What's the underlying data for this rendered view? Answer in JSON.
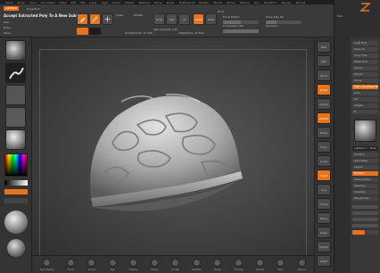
{
  "menubar": {
    "items": [
      "Alpha",
      "Brush",
      "Color",
      "Document",
      "Draw",
      "Edit",
      "File",
      "Layer",
      "Light",
      "Macro",
      "Marker",
      "Material",
      "Movie",
      "Picker",
      "Preferences",
      "Render",
      "Stencil",
      "Stroke",
      "Texture",
      "Tool",
      "Transform",
      "Zplugin",
      "Zscript"
    ],
    "quick_menu_label": "?"
  },
  "toptools": {
    "lightbox_label": "LightBox",
    "projection_label": "Projection",
    "accept_label": "Accept Extracted Poly To A New Subtool",
    "scale_label": "Scale",
    "rotate_label": "Rotate",
    "mrgb_label": "Mrgb",
    "rgb_label": "Rgb",
    "m_label": "M",
    "zadd_label": "Zadd",
    "zsub_label": "Zsub",
    "zcut_label": "Zcut",
    "focal_label": "Focal Shift 0",
    "intensity_label": "Z Intensity 100",
    "draw_size_label": "Draw Size 64",
    "dynamic_label": "Dynamic",
    "active_points": "ActivePoints: 47,529",
    "total_points": "TotalPoints: 47,529",
    "rgb_intensity_label": "Rgb Intensity 100",
    "edit_label": "Edit",
    "draw_label": "Draw",
    "move_label": "Move",
    "scale_tool_label": "Scale",
    "rotate_tool_label": "Rotate"
  },
  "colors": {
    "accent": "#e8731b",
    "ui_bg": "#3a3a3a",
    "dark_bg": "#2a2a2a",
    "mesh": "#b5b5b5"
  },
  "leftshelf": {
    "items": [
      "Brush",
      "Stroke",
      "Alpha",
      "Texture",
      "Material",
      "Color",
      "Gradient",
      "SwitchColor",
      "Alternate"
    ]
  },
  "bottombar": {
    "items": [
      "Symmetry",
      "Floor",
      "Local",
      "Xyz",
      "Frame",
      "Move",
      "Scale",
      "Rotate",
      "PolyF",
      "Transp",
      "Ghost",
      "Solo",
      "Xpose"
    ]
  },
  "rightshelf": {
    "items": [
      "BPR",
      "SPix",
      "Scroll",
      "Zoom",
      "Actual",
      "AAHalf",
      "Persp",
      "Floor",
      "Local",
      "LSym",
      "Xyz",
      "Frame",
      "Move",
      "Scale",
      "Rotate",
      "PolyF",
      "Transp",
      "Solo",
      "Xpose"
    ]
  },
  "toolpal": {
    "title": "Tool",
    "lines": [
      "Load Tool",
      "Save As",
      "Copy Tool",
      "Paste Tool",
      "Import",
      "Export",
      "Clone",
      "Make PolyMesh3D",
      "GoZ",
      "All",
      "Visible",
      "R",
      "Lightbox > Tools",
      "SubTool",
      "Geometry",
      "Layers",
      "Extract",
      "Deformation",
      "Masking",
      "Visibility",
      "Polygroups"
    ]
  }
}
